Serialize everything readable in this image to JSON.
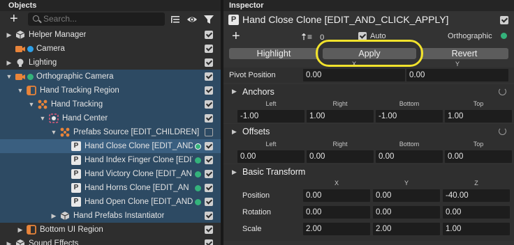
{
  "objects_panel": {
    "title": "Objects",
    "search_placeholder": "Search...",
    "icons": [
      "plus-icon",
      "search-icon",
      "filter-list-icon",
      "visibility-eye-icon",
      "funnel-icon"
    ]
  },
  "tree": [
    {
      "label": "Helper Manager",
      "arrow": "▶",
      "icon": "prefab-cube-icon",
      "enabled": true
    },
    {
      "label": "Camera",
      "arrow": "",
      "icon": "camera-icon",
      "dot": "#2ea0e8",
      "enabled": true
    },
    {
      "label": "Lighting",
      "arrow": "▶",
      "icon": "light-icon",
      "enabled": true
    },
    {
      "label": "Orthographic Camera",
      "arrow": "▼",
      "icon": "camera-icon",
      "dot": "#34b27b",
      "enabled": true
    },
    {
      "label": "Hand Tracking Region",
      "arrow": "▼",
      "icon": "screen-region-icon",
      "enabled": true
    },
    {
      "label": "Hand Tracking",
      "arrow": "▼",
      "icon": "hand-tracking-icon",
      "enabled": true
    },
    {
      "label": "Hand Center",
      "arrow": "▼",
      "icon": "hand-center-icon",
      "enabled": true
    },
    {
      "label": "Prefabs Source [EDIT_CHILDREN]",
      "arrow": "▼",
      "icon": "prefabs-source-icon",
      "enabled": false
    },
    {
      "label": "Hand Close Clone [EDIT_AND",
      "arrow": "",
      "icon": "image-p-icon",
      "dot": "#34b27b",
      "enabled": true
    },
    {
      "label": "Hand Index Finger Clone [EDIT",
      "arrow": "",
      "icon": "image-p-icon",
      "dot": "#34b27b",
      "enabled": true
    },
    {
      "label": "Hand Victory Clone [EDIT_AN",
      "arrow": "",
      "icon": "image-p-icon",
      "dot": "#34b27b",
      "enabled": true
    },
    {
      "label": "Hand Horns Clone [EDIT_AN",
      "arrow": "",
      "icon": "image-p-icon",
      "dot": "#34b27b",
      "enabled": true
    },
    {
      "label": "Hand Open Clone [EDIT_AND",
      "arrow": "",
      "icon": "image-p-icon",
      "dot": "#34b27b",
      "enabled": true
    },
    {
      "label": "Hand Prefabs Instantiator",
      "arrow": "▶",
      "icon": "prefab-cube-icon",
      "enabled": true
    },
    {
      "label": "Bottom UI Region",
      "arrow": "▶",
      "icon": "screen-region-icon",
      "enabled": true
    },
    {
      "label": "Sound Effects",
      "arrow": "▶",
      "icon": "prefab-cube-icon",
      "enabled": true
    }
  ],
  "inspector": {
    "title": "Inspector",
    "object_name": "Hand Close Clone [EDIT_AND_CLICK_APPLY]",
    "layer_count": "0",
    "auto_label": "Auto",
    "render_layer": "Orthographic",
    "buttons": {
      "highlight": "Highlight",
      "apply": "Apply",
      "revert": "Revert"
    },
    "pivot": {
      "label": "Pivot Position",
      "cols": [
        "X",
        "Y"
      ],
      "values": [
        "0.00",
        "0.00"
      ]
    },
    "anchors": {
      "label": "Anchors",
      "cols": [
        "Left",
        "Right",
        "Bottom",
        "Top"
      ],
      "values": [
        "-1.00",
        "1.00",
        "-1.00",
        "1.00"
      ]
    },
    "offsets": {
      "label": "Offsets",
      "cols": [
        "Left",
        "Right",
        "Bottom",
        "Top"
      ],
      "values": [
        "0.00",
        "0.00",
        "0.00",
        "0.00"
      ]
    },
    "basic_transform": {
      "label": "Basic Transform",
      "cols": [
        "X",
        "Y",
        "Z"
      ],
      "rows": [
        {
          "label": "Position",
          "values": [
            "0.00",
            "0.00",
            "-40.00"
          ]
        },
        {
          "label": "Rotation",
          "values": [
            "0.00",
            "0.00",
            "0.00"
          ]
        },
        {
          "label": "Scale",
          "values": [
            "2.00",
            "2.00",
            "1.00"
          ]
        }
      ]
    }
  },
  "colors": {
    "accent_green": "#34b27b",
    "accent_blue": "#2ea0e8",
    "selection": "#3a5f80",
    "highlight_ring": "#f1e22c"
  }
}
